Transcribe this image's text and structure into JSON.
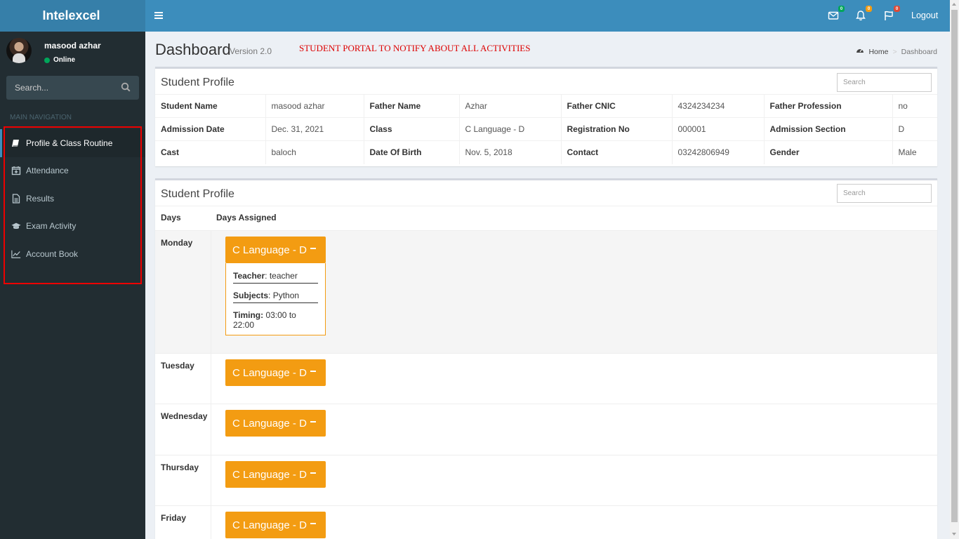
{
  "app": {
    "brand": "Intelexcel"
  },
  "user": {
    "name": "masood azhar",
    "status": "Online"
  },
  "sidebar": {
    "search_placeholder": "Search...",
    "nav_header": "MAIN NAVIGATION",
    "items": [
      {
        "label": "Profile & Class Routine",
        "icon": "book-icon"
      },
      {
        "label": "Attendance",
        "icon": "calendar-plus-icon"
      },
      {
        "label": "Results",
        "icon": "document-icon"
      },
      {
        "label": "Exam Activity",
        "icon": "graduation-cap-icon"
      },
      {
        "label": "Account Book",
        "icon": "line-chart-icon"
      }
    ]
  },
  "navbar": {
    "messages_count": "0",
    "notifications_count": "0",
    "flags_count": "0",
    "logout_label": "Logout",
    "colors": {
      "messages": "#00a65a",
      "notifications": "#f39c12",
      "flags": "#dd4b39"
    }
  },
  "header": {
    "title": "Dashboard",
    "version": "Version 2.0",
    "notice": "STUDENT PORTAL TO NOTIFY ABOUT ALL ACTIVITIES",
    "breadcrumb_home": "Home",
    "breadcrumb_current": "Dashboard"
  },
  "profile": {
    "title": "Student Profile",
    "search_placeholder": "Search",
    "rows": [
      [
        {
          "label": "Student Name",
          "value": "masood azhar"
        },
        {
          "label": "Father Name",
          "value": "Azhar"
        },
        {
          "label": "Father CNIC",
          "value": "4324234234"
        },
        {
          "label": "Father Profession",
          "value": "no"
        }
      ],
      [
        {
          "label": "Admission Date",
          "value": "Dec. 31, 2021"
        },
        {
          "label": "Class",
          "value": "C Language - D"
        },
        {
          "label": "Registration No",
          "value": "000001"
        },
        {
          "label": "Admission Section",
          "value": "D"
        }
      ],
      [
        {
          "label": "Cast",
          "value": "baloch"
        },
        {
          "label": "Date Of Birth",
          "value": "Nov. 5, 2018"
        },
        {
          "label": "Contact",
          "value": "03242806949"
        },
        {
          "label": "Gender",
          "value": "Male"
        }
      ]
    ]
  },
  "routine": {
    "title": "Student Profile",
    "search_placeholder": "Search",
    "col_days": "Days",
    "col_assigned": "Days Assigned",
    "days": [
      {
        "day": "Monday",
        "class": "C Language - D",
        "teacher_label": "Teacher",
        "teacher": "teacher",
        "subjects_label": "Subjects",
        "subjects": "Python",
        "timing_label": "Timing:",
        "timing": "03:00 to 22:00"
      },
      {
        "day": "Tuesday",
        "class": "C Language - D"
      },
      {
        "day": "Wednesday",
        "class": "C Language - D"
      },
      {
        "day": "Thursday",
        "class": "C Language - D"
      },
      {
        "day": "Friday",
        "class": "C Language - D"
      }
    ]
  }
}
